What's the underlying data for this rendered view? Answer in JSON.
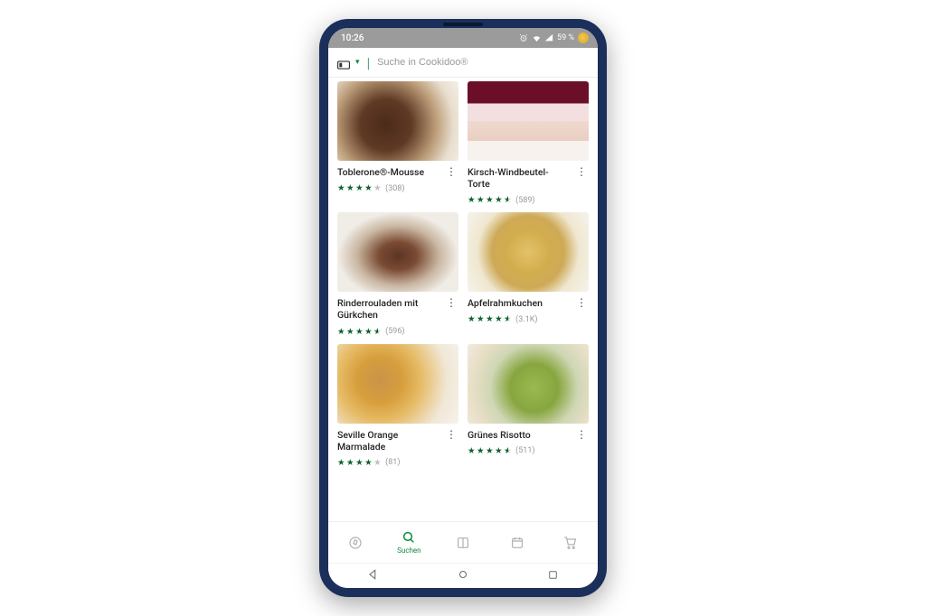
{
  "status": {
    "time": "10:26",
    "battery_text": "59 %"
  },
  "search": {
    "placeholder": "Suche in Cookidoo®"
  },
  "recipes": [
    {
      "title": "Toblerone®-Mousse",
      "rating": 4.0,
      "count": "(308)",
      "img": "img-mousse"
    },
    {
      "title": "Kirsch-Windbeutel-Torte",
      "rating": 4.5,
      "count": "(589)",
      "img": "img-torte"
    },
    {
      "title": "Rinderrouladen mit Gürkchen",
      "rating": 4.5,
      "count": "(596)",
      "img": "img-roul"
    },
    {
      "title": "Apfelrahmkuchen",
      "rating": 4.5,
      "count": "(3.1K)",
      "img": "img-apfel"
    },
    {
      "title": "Seville Orange Marmalade",
      "rating": 4.0,
      "count": "(81)",
      "img": "img-marm"
    },
    {
      "title": "Grünes Risotto",
      "rating": 4.5,
      "count": "(511)",
      "img": "img-risotto"
    }
  ],
  "nav": {
    "items": [
      {
        "label": "",
        "icon": "compass"
      },
      {
        "label": "Suchen",
        "icon": "search",
        "active": true
      },
      {
        "label": "",
        "icon": "book"
      },
      {
        "label": "",
        "icon": "calendar"
      },
      {
        "label": "",
        "icon": "cart"
      }
    ]
  }
}
